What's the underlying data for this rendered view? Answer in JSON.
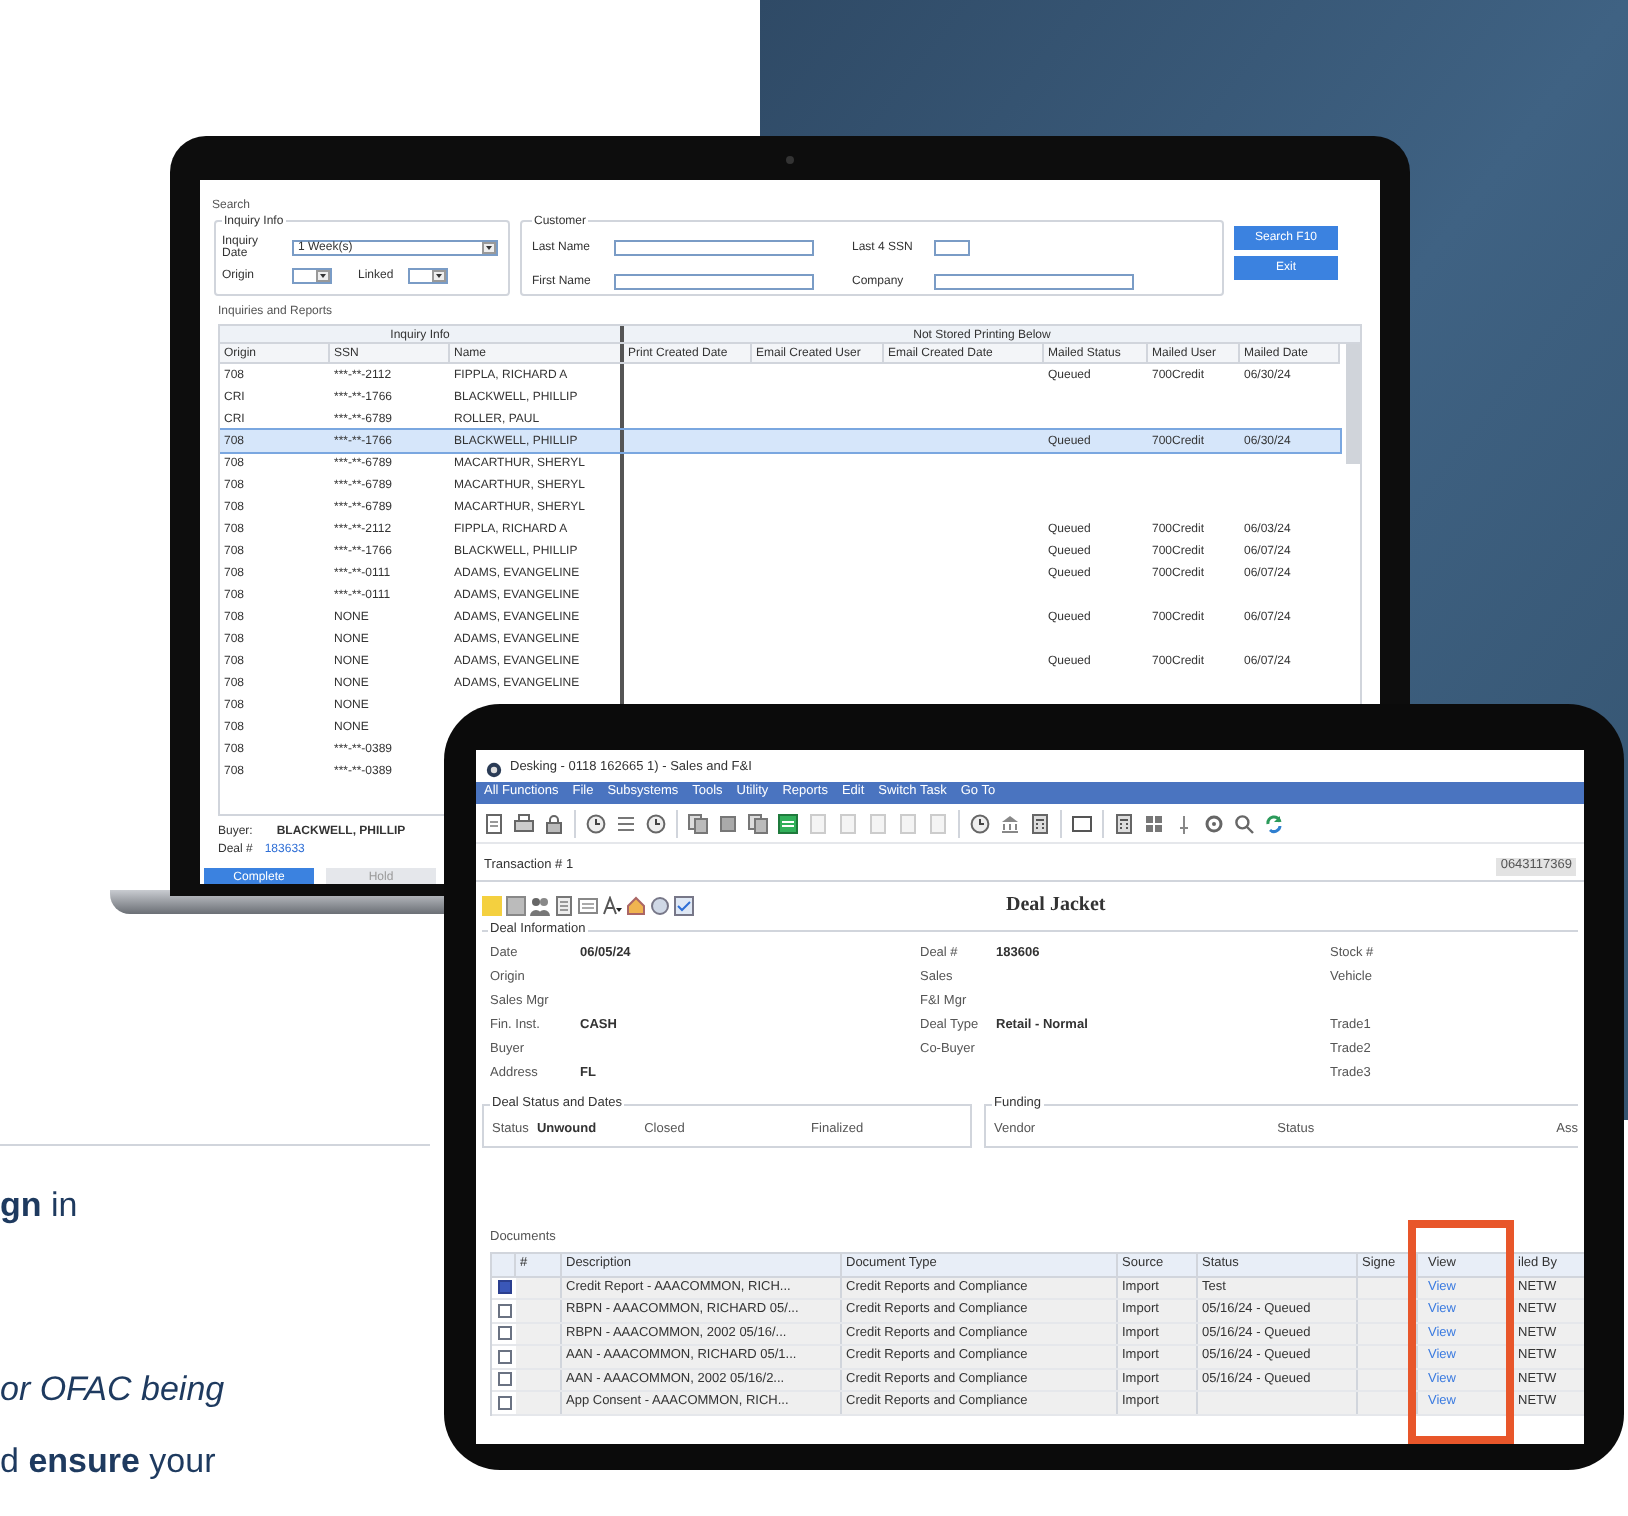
{
  "page_text": {
    "lines": [
      "**gn** in",
      "*or OFAC being*",
      "d **ensure** your"
    ]
  },
  "laptop": {
    "search_title": "Search",
    "inquiry_group": {
      "title": "Inquiry Info",
      "date_label": "Inquiry Date",
      "date_value": "1 Week(s)",
      "origin_label": "Origin",
      "linked_label": "Linked"
    },
    "customer_group": {
      "title": "Customer",
      "fields": [
        {
          "label": "Last Name"
        },
        {
          "label": "Last 4 SSN"
        },
        {
          "label": "First Name"
        },
        {
          "label": "Company"
        }
      ]
    },
    "buttons": [
      "Search F10",
      "Exit"
    ],
    "table_title": "Inquiries and Reports",
    "column_groups": [
      "Inquiry Info",
      "Not Stored Printing Below"
    ],
    "columns": [
      "Origin",
      "SSN",
      "Name",
      "Print Created Date",
      "Email Created User",
      "Email Created Date",
      "Mailed Status",
      "Mailed User",
      "Mailed Date"
    ],
    "rows": [
      {
        "origin": "708",
        "ssn": "***-**-2112",
        "name": "FIPPLA, RICHARD A",
        "mailed_status": "Queued",
        "mailed_user": "700Credit",
        "mailed_date": "06/30/24",
        "selected": false
      },
      {
        "origin": "CRI",
        "ssn": "***-**-1766",
        "name": "BLACKWELL, PHILLIP",
        "selected": false
      },
      {
        "origin": "CRI",
        "ssn": "***-**-6789",
        "name": "ROLLER, PAUL",
        "selected": false
      },
      {
        "origin": "708",
        "ssn": "***-**-1766",
        "name": "BLACKWELL, PHILLIP",
        "mailed_status": "Queued",
        "mailed_user": "700Credit",
        "mailed_date": "06/30/24",
        "selected": true
      },
      {
        "origin": "708",
        "ssn": "***-**-6789",
        "name": "MACARTHUR, SHERYL",
        "selected": false
      },
      {
        "origin": "708",
        "ssn": "***-**-6789",
        "name": "MACARTHUR, SHERYL",
        "selected": false
      },
      {
        "origin": "708",
        "ssn": "***-**-6789",
        "name": "MACARTHUR, SHERYL",
        "selected": false
      },
      {
        "origin": "708",
        "ssn": "***-**-2112",
        "name": "FIPPLA, RICHARD A",
        "mailed_status": "Queued",
        "mailed_user": "700Credit",
        "mailed_date": "06/03/24",
        "selected": false
      },
      {
        "origin": "708",
        "ssn": "***-**-1766",
        "name": "BLACKWELL, PHILLIP",
        "mailed_status": "Queued",
        "mailed_user": "700Credit",
        "mailed_date": "06/07/24",
        "selected": false
      },
      {
        "origin": "708",
        "ssn": "***-**-0111",
        "name": "ADAMS, EVANGELINE",
        "mailed_status": "Queued",
        "mailed_user": "700Credit",
        "mailed_date": "06/07/24",
        "selected": false
      },
      {
        "origin": "708",
        "ssn": "***-**-0111",
        "name": "ADAMS, EVANGELINE",
        "selected": false
      },
      {
        "origin": "708",
        "ssn": "NONE",
        "name": "ADAMS, EVANGELINE",
        "mailed_status": "Queued",
        "mailed_user": "700Credit",
        "mailed_date": "06/07/24",
        "selected": false
      },
      {
        "origin": "708",
        "ssn": "NONE",
        "name": "ADAMS, EVANGELINE",
        "selected": false
      },
      {
        "origin": "708",
        "ssn": "NONE",
        "name": "ADAMS, EVANGELINE",
        "mailed_status": "Queued",
        "mailed_user": "700Credit",
        "mailed_date": "06/07/24",
        "selected": false
      },
      {
        "origin": "708",
        "ssn": "NONE",
        "name": "ADAMS, EVANGELINE",
        "selected": false
      },
      {
        "origin": "708",
        "ssn": "NONE",
        "selected": false
      },
      {
        "origin": "708",
        "ssn": "NONE",
        "selected": false
      },
      {
        "origin": "708",
        "ssn": "***-**-0389",
        "selected": false
      },
      {
        "origin": "708",
        "ssn": "***-**-0389",
        "selected": false
      }
    ],
    "buyer_label": "Buyer:",
    "buyer_value": "BLACKWELL, PHILLIP",
    "deal_label": "Deal #",
    "deal_link": "183633",
    "footer_buttons": [
      {
        "label": "Complete",
        "kind": "primary"
      },
      {
        "label": "Hold",
        "kind": "secondary"
      }
    ]
  },
  "tablet": {
    "title": "Desking - 0118 162665 1) - Sales and F&I",
    "menu": [
      "All Functions",
      "File",
      "Subsystems",
      "Tools",
      "Utility",
      "Reports",
      "Edit",
      "Switch Task",
      "Go To"
    ],
    "transaction": "Transaction # 1",
    "record_id": "0643117369",
    "heading": "Deal Jacket",
    "deal_info": {
      "title": "Deal Information",
      "columns": [
        [
          {
            "kind": "field",
            "label": "Date",
            "value": "06/05/24"
          },
          {
            "kind": "field",
            "label": "Origin"
          },
          {
            "kind": "field",
            "label": "Sales Mgr"
          },
          {
            "kind": "field",
            "label": "Fin. Inst.",
            "value": "CASH"
          },
          {
            "kind": "field",
            "label": "Buyer"
          },
          {
            "kind": "field",
            "label": "Address",
            "value": "FL"
          }
        ],
        [
          {
            "kind": "field",
            "label": "Deal #",
            "value": "183606"
          },
          {
            "kind": "field",
            "label": "Sales"
          },
          {
            "kind": "field",
            "label": "F&I Mgr"
          },
          {
            "kind": "field",
            "label": "Deal Type",
            "value": "Retail - Normal"
          },
          {
            "kind": "field",
            "label": "Co-Buyer"
          }
        ],
        [
          {
            "kind": "field",
            "label": "Stock #"
          },
          {
            "kind": "field",
            "label": "Vehicle"
          },
          {
            "kind": "blank"
          },
          {
            "kind": "field",
            "label": "Trade1"
          },
          {
            "kind": "field",
            "label": "Trade2"
          },
          {
            "kind": "field",
            "label": "Trade3"
          }
        ]
      ]
    },
    "status_group": {
      "title": "Deal Status and Dates",
      "status_label": "Status",
      "status_value": "Unwound",
      "items": [
        "Closed",
        "Finalized"
      ]
    },
    "funding_group": {
      "title": "Funding",
      "columns": [
        "Vendor",
        "Status",
        "Ass"
      ]
    },
    "documents": {
      "title": "Documents",
      "columns": [
        "#",
        "Description",
        "Document Type",
        "Source",
        "Status",
        "Signe",
        "View",
        "iled By"
      ],
      "rows": [
        {
          "checked": true,
          "description": "Credit Report - AAACOMMON, RICH...",
          "document_type": "Credit Reports and Compliance",
          "source": "Import",
          "status": "Test",
          "view": "View",
          "filed_by": "NETW"
        },
        {
          "checked": false,
          "description": "RBPN - AAACOMMON, RICHARD 05/...",
          "document_type": "Credit Reports and Compliance",
          "source": "Import",
          "status": "05/16/24 - Queued",
          "view": "View",
          "filed_by": "NETW"
        },
        {
          "checked": false,
          "description": "RBPN - AAACOMMON, 2002 05/16/...",
          "document_type": "Credit Reports and Compliance",
          "source": "Import",
          "status": "05/16/24 - Queued",
          "view": "View",
          "filed_by": "NETW"
        },
        {
          "checked": false,
          "description": "AAN - AAACOMMON, RICHARD 05/1...",
          "document_type": "Credit Reports and Compliance",
          "source": "Import",
          "status": "05/16/24 - Queued",
          "view": "View",
          "filed_by": "NETW"
        },
        {
          "checked": false,
          "description": "AAN - AAACOMMON, 2002 05/16/2...",
          "document_type": "Credit Reports and Compliance",
          "source": "Import",
          "status": "05/16/24 - Queued",
          "view": "View",
          "filed_by": "NETW"
        },
        {
          "checked": false,
          "description": "App Consent - AAACOMMON, RICH...",
          "document_type": "Credit Reports and Compliance",
          "source": "Import",
          "view": "View",
          "filed_by": "NETW"
        }
      ]
    }
  }
}
